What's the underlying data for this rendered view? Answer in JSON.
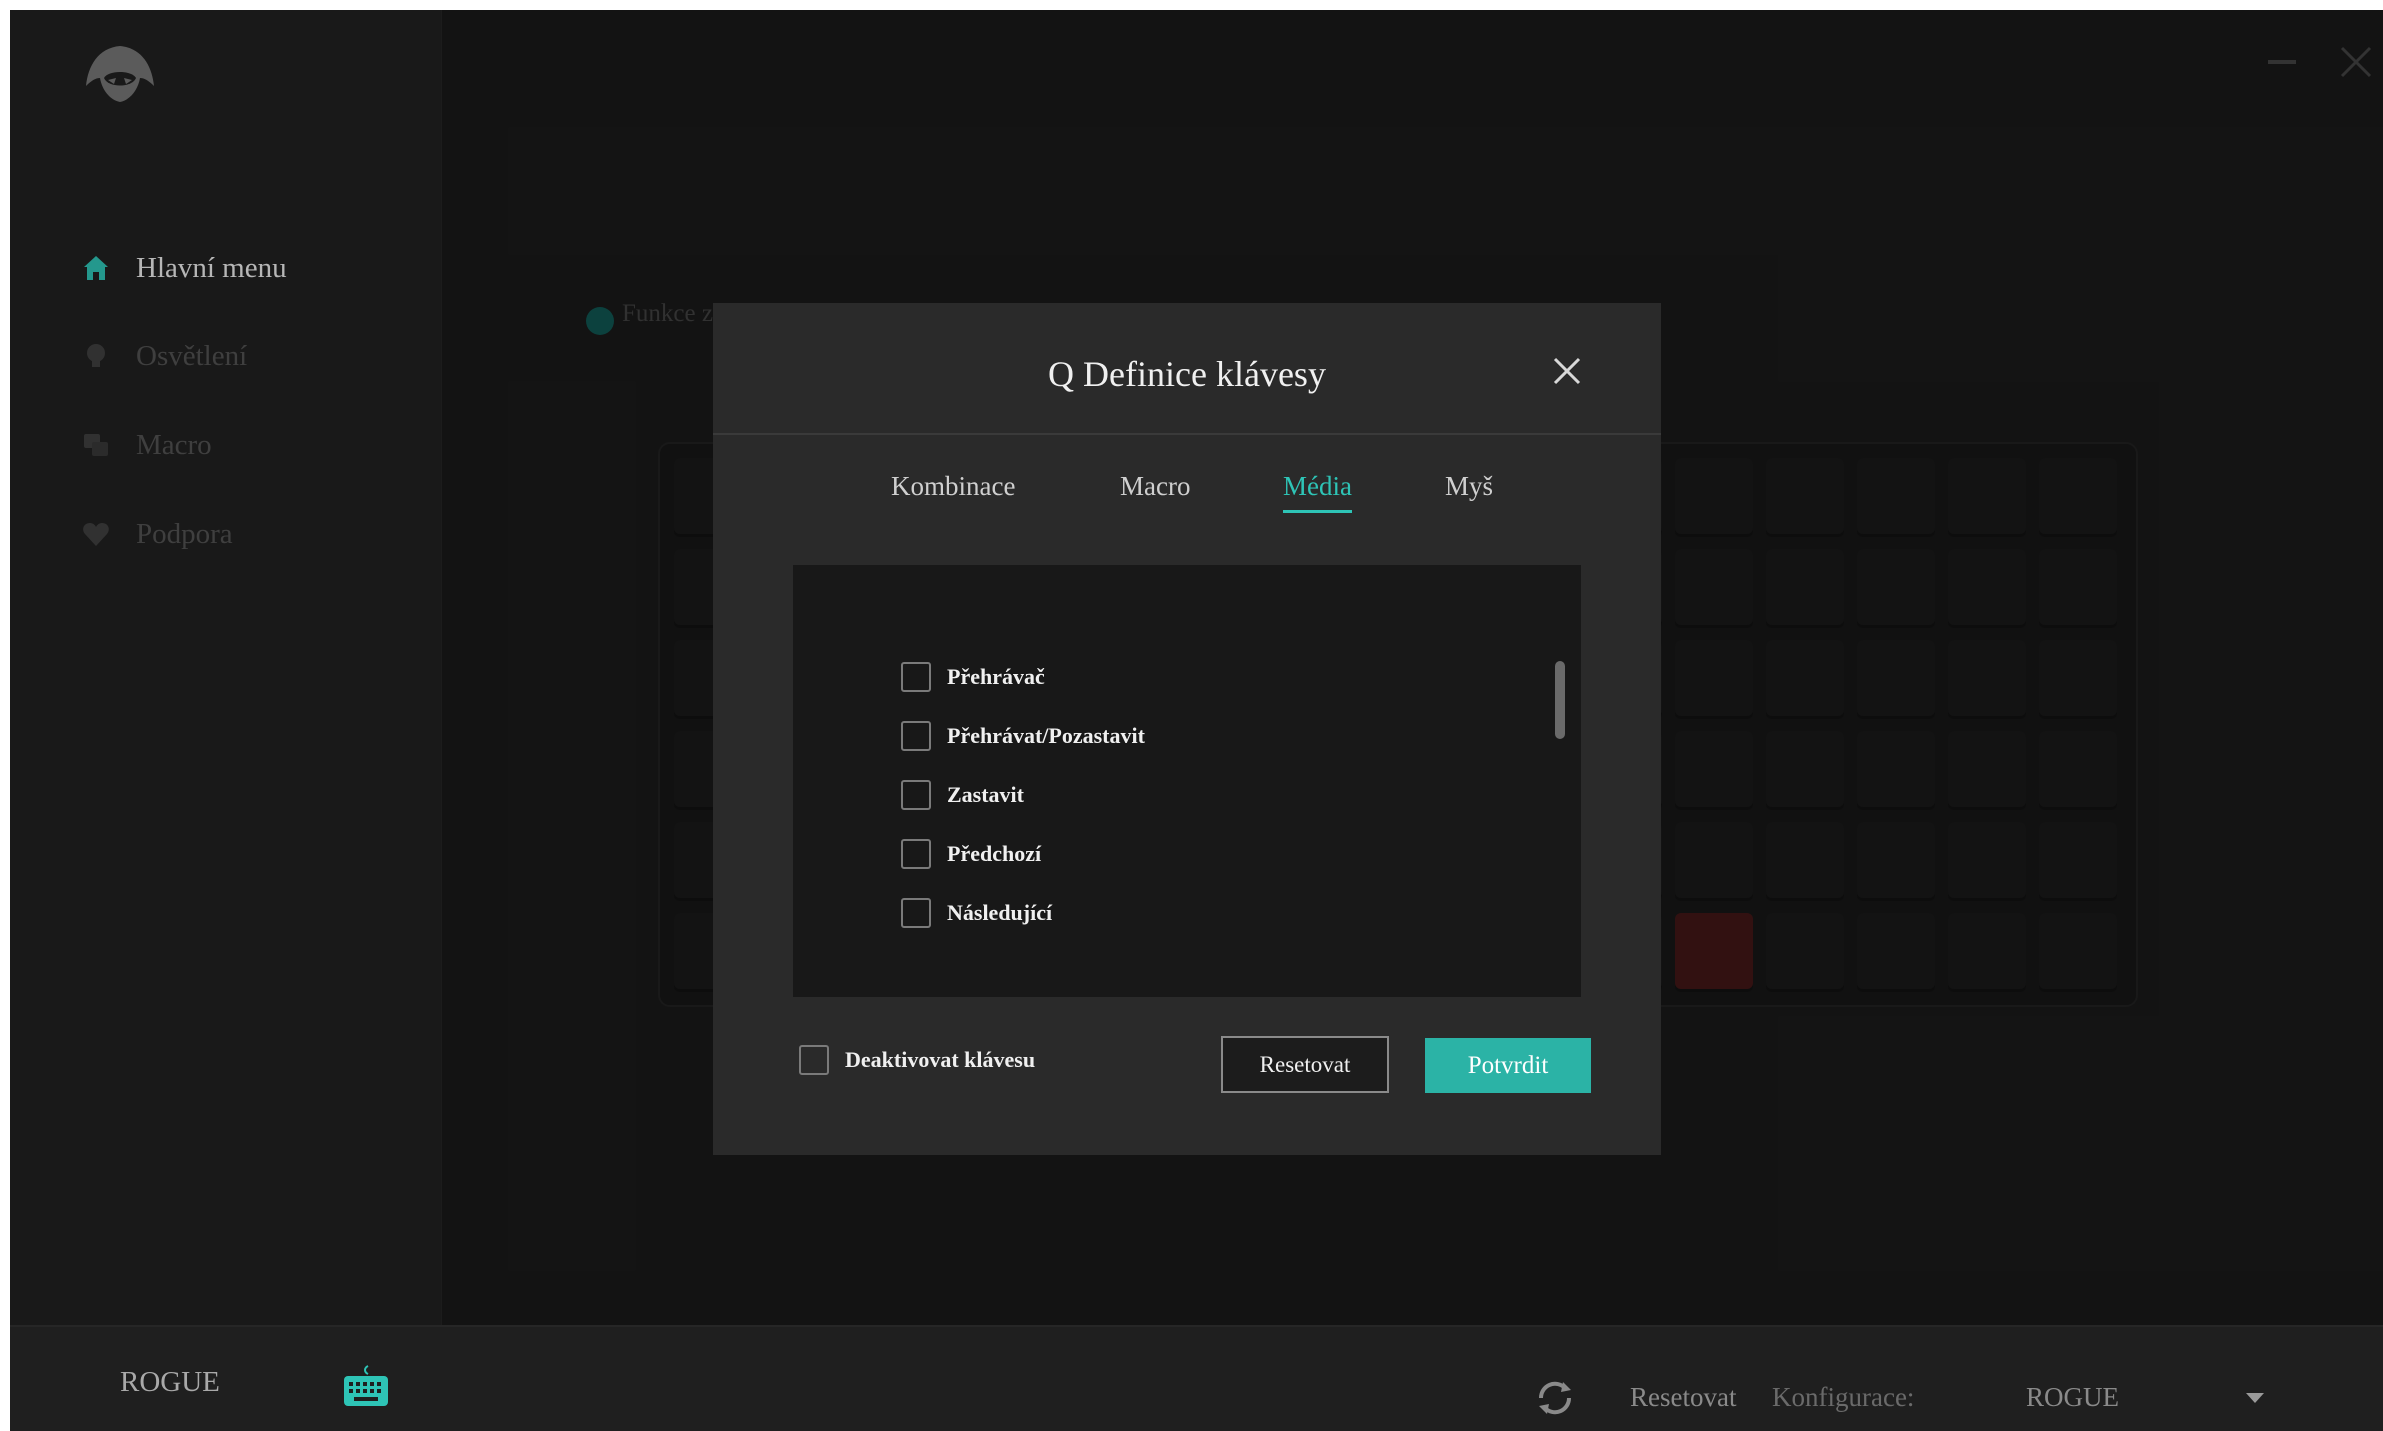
{
  "sidebar": {
    "logo_icon": "hooded-rogue-logo-icon",
    "items": [
      {
        "label": "Hlavní menu",
        "icon": "home-icon",
        "active": true
      },
      {
        "label": "Osvětlení",
        "icon": "bulb-icon",
        "active": false
      },
      {
        "label": "Macro",
        "icon": "macro-icon",
        "active": false
      },
      {
        "label": "Podpora",
        "icon": "heart-icon",
        "active": false
      }
    ]
  },
  "background": {
    "function_label": "Funkce z"
  },
  "modal": {
    "title": "Q Definice klávesy",
    "tabs": [
      {
        "label": "Kombinace",
        "active": false
      },
      {
        "label": "Macro",
        "active": false
      },
      {
        "label": "Média",
        "active": true
      },
      {
        "label": "Myš",
        "active": false
      }
    ],
    "media_options": [
      {
        "label": "Přehrávač",
        "checked": false
      },
      {
        "label": "Přehrávat/Pozastavit",
        "checked": false
      },
      {
        "label": "Zastavit",
        "checked": false
      },
      {
        "label": "Předchozí",
        "checked": false
      },
      {
        "label": "Následující",
        "checked": false
      }
    ],
    "deactivate_label": "Deaktivovat klávesu",
    "reset_label": "Resetovat",
    "confirm_label": "Potvrdit"
  },
  "footer": {
    "device_name": "ROGUE",
    "device_icon": "keyboard-icon",
    "refresh_icon": "refresh-icon",
    "reset_label": "Resetovat",
    "config_label": "Konfigurace:",
    "profile_value": "ROGUE"
  },
  "colors": {
    "accent": "#2bb3a6",
    "background": "#1b1b1b",
    "modal": "#2a2a2a"
  }
}
